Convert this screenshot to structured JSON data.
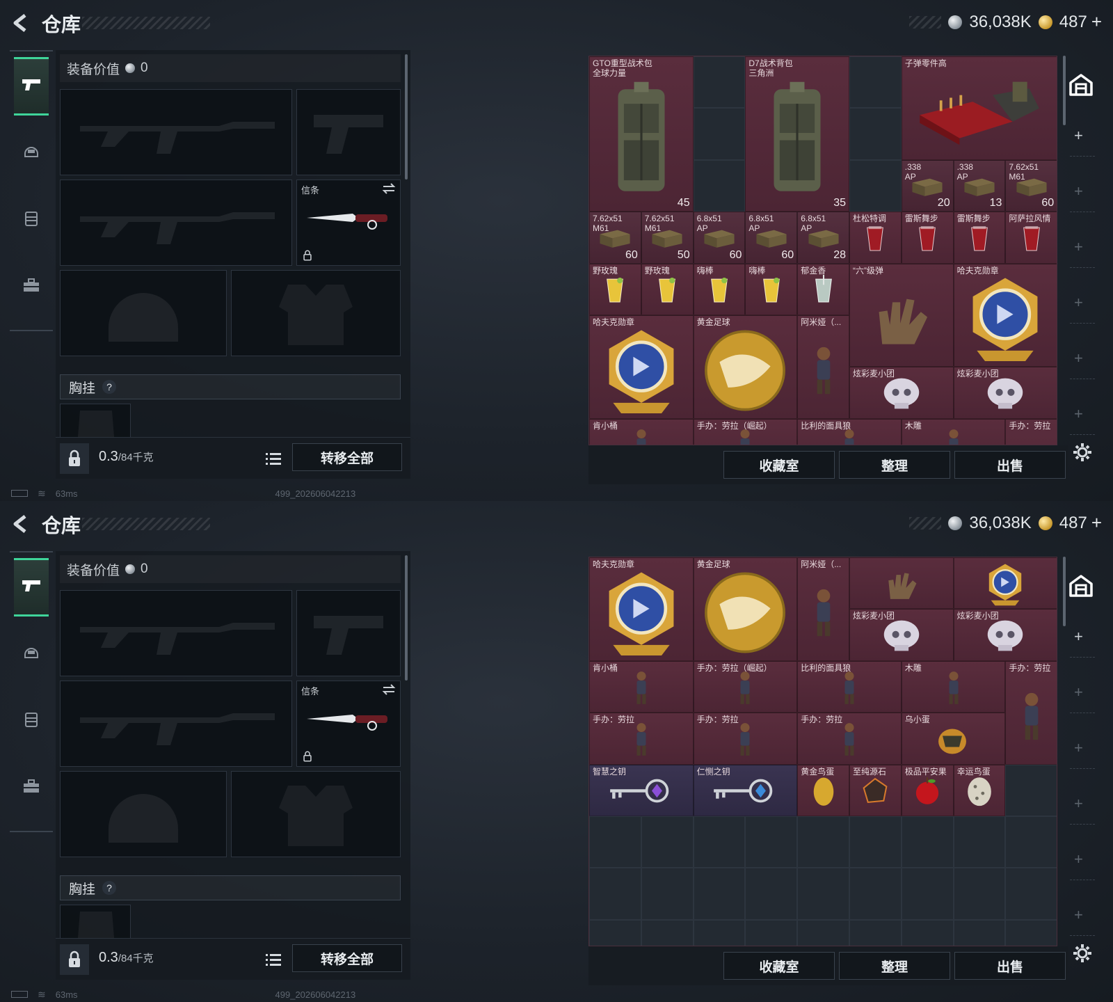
{
  "screens": [
    {
      "title": "仓库",
      "currency": {
        "silver": "36,038K",
        "gold": "487"
      },
      "equip_value_label": "装备价值",
      "equip_value": "0",
      "melee_slot_label": "信条",
      "chest_label": "胸挂",
      "weight_value": "0.3",
      "weight_unit": "/84千克",
      "transfer_all": "转移全部",
      "status_ping": "63ms",
      "status_id": "499_202606042213",
      "actions": [
        "收藏室",
        "整理",
        "出售"
      ],
      "stash_items": [
        {
          "name": "GTO重型战术包\n全球力量",
          "qty": "45",
          "tint": "maroon",
          "c": 0,
          "r": 0,
          "w": 2,
          "h": 3,
          "art": "backpack"
        },
        {
          "name": "D7战术背包\n三角洲",
          "qty": "35",
          "tint": "maroon",
          "c": 3,
          "r": 0,
          "w": 2,
          "h": 3,
          "art": "backpack"
        },
        {
          "name": "子弹零件高",
          "qty": "",
          "tint": "maroon",
          "c": 6,
          "r": 0,
          "w": 3,
          "h": 2,
          "art": "ammo-case"
        },
        {
          "name": ".338\nAP",
          "qty": "20",
          "tint": "maroon2",
          "c": 6,
          "r": 2,
          "w": 1,
          "h": 1,
          "art": "box"
        },
        {
          "name": ".338\nAP",
          "qty": "13",
          "tint": "maroon2",
          "c": 7,
          "r": 2,
          "w": 1,
          "h": 1,
          "art": "box"
        },
        {
          "name": "7.62x51\nM61",
          "qty": "60",
          "tint": "maroon2",
          "c": 8,
          "r": 2,
          "w": 1,
          "h": 1,
          "art": "box"
        },
        {
          "name": "7.62x51\nM61",
          "qty": "60",
          "tint": "maroon2",
          "c": 0,
          "r": 3,
          "w": 1,
          "h": 1,
          "art": "box"
        },
        {
          "name": "7.62x51\nM61",
          "qty": "50",
          "tint": "maroon2",
          "c": 1,
          "r": 3,
          "w": 1,
          "h": 1,
          "art": "box"
        },
        {
          "name": "6.8x51\nAP",
          "qty": "60",
          "tint": "maroon2",
          "c": 2,
          "r": 3,
          "w": 1,
          "h": 1,
          "art": "box"
        },
        {
          "name": "6.8x51\nAP",
          "qty": "60",
          "tint": "maroon2",
          "c": 3,
          "r": 3,
          "w": 1,
          "h": 1,
          "art": "box"
        },
        {
          "name": "6.8x51\nAP",
          "qty": "28",
          "tint": "maroon2",
          "c": 4,
          "r": 3,
          "w": 1,
          "h": 1,
          "art": "box"
        },
        {
          "name": "杜松特调",
          "qty": "",
          "tint": "maroon",
          "c": 5,
          "r": 3,
          "w": 1,
          "h": 1,
          "art": "drink-red"
        },
        {
          "name": "雷斯舞步",
          "qty": "",
          "tint": "maroon",
          "c": 6,
          "r": 3,
          "w": 1,
          "h": 1,
          "art": "drink-red"
        },
        {
          "name": "雷斯舞步",
          "qty": "",
          "tint": "maroon",
          "c": 7,
          "r": 3,
          "w": 1,
          "h": 1,
          "art": "drink-red"
        },
        {
          "name": "阿萨拉风情",
          "qty": "",
          "tint": "maroon",
          "c": 8,
          "r": 3,
          "w": 1,
          "h": 1,
          "art": "drink-red"
        },
        {
          "name": "野玫瑰",
          "qty": "",
          "tint": "maroon",
          "c": 0,
          "r": 4,
          "w": 1,
          "h": 1,
          "art": "drink-yellow"
        },
        {
          "name": "野玫瑰",
          "qty": "",
          "tint": "maroon",
          "c": 1,
          "r": 4,
          "w": 1,
          "h": 1,
          "art": "drink-yellow"
        },
        {
          "name": "嗨棒",
          "qty": "",
          "tint": "maroon",
          "c": 2,
          "r": 4,
          "w": 1,
          "h": 1,
          "art": "drink-yellow"
        },
        {
          "name": "嗨棒",
          "qty": "",
          "tint": "maroon",
          "c": 3,
          "r": 4,
          "w": 1,
          "h": 1,
          "art": "drink-yellow"
        },
        {
          "name": "郁金香",
          "qty": "",
          "tint": "maroon",
          "c": 4,
          "r": 4,
          "w": 1,
          "h": 1,
          "art": "drink-clear"
        },
        {
          "name": "“六”级弹",
          "qty": "",
          "tint": "maroon",
          "c": 5,
          "r": 4,
          "w": 2,
          "h": 2,
          "art": "hand"
        },
        {
          "name": "哈夫克勋章",
          "qty": "",
          "tint": "maroon",
          "c": 7,
          "r": 4,
          "w": 2,
          "h": 2,
          "art": "medal"
        },
        {
          "name": "哈夫克勋章",
          "qty": "",
          "tint": "maroon",
          "c": 0,
          "r": 5,
          "w": 2,
          "h": 2,
          "art": "medal"
        },
        {
          "name": "黄金足球",
          "qty": "",
          "tint": "maroon",
          "c": 2,
          "r": 5,
          "w": 2,
          "h": 2,
          "art": "ball"
        },
        {
          "name": "阿米娅（...",
          "qty": "",
          "tint": "maroon",
          "c": 4,
          "r": 5,
          "w": 1,
          "h": 2,
          "art": "figure"
        },
        {
          "name": "炫彩麦小团",
          "qty": "",
          "tint": "maroon",
          "c": 5,
          "r": 6,
          "w": 2,
          "h": 1,
          "art": "skull"
        },
        {
          "name": "炫彩麦小团",
          "qty": "",
          "tint": "maroon",
          "c": 7,
          "r": 6,
          "w": 2,
          "h": 1,
          "art": "skull"
        },
        {
          "name": "肯小桶",
          "qty": "",
          "tint": "maroon",
          "c": 0,
          "r": 7,
          "w": 2,
          "h": 1,
          "art": "figure"
        },
        {
          "name": "手办：劳拉（崛起）",
          "qty": "",
          "tint": "maroon",
          "c": 2,
          "r": 7,
          "w": 2,
          "h": 1,
          "art": "figure"
        },
        {
          "name": "比利的面具狼",
          "qty": "",
          "tint": "maroon",
          "c": 4,
          "r": 7,
          "w": 2,
          "h": 1,
          "art": "figure"
        },
        {
          "name": "木雕",
          "qty": "",
          "tint": "maroon",
          "c": 6,
          "r": 7,
          "w": 2,
          "h": 1,
          "art": "figure"
        },
        {
          "name": "手办：劳拉",
          "qty": "",
          "tint": "maroon",
          "c": 8,
          "r": 7,
          "w": 1,
          "h": 2,
          "art": "figure"
        }
      ]
    },
    {
      "title": "仓库",
      "currency": {
        "silver": "36,038K",
        "gold": "487"
      },
      "equip_value_label": "装备价值",
      "equip_value": "0",
      "melee_slot_label": "信条",
      "chest_label": "胸挂",
      "weight_value": "0.3",
      "weight_unit": "/84千克",
      "transfer_all": "转移全部",
      "status_ping": "63ms",
      "status_id": "499_202606042213",
      "actions": [
        "收藏室",
        "整理",
        "出售"
      ],
      "stash_items": [
        {
          "name": "哈夫克勋章",
          "qty": "",
          "tint": "maroon",
          "c": 0,
          "r": 0,
          "w": 2,
          "h": 2,
          "art": "medal"
        },
        {
          "name": "黄金足球",
          "qty": "",
          "tint": "maroon",
          "c": 2,
          "r": 0,
          "w": 2,
          "h": 2,
          "art": "ball"
        },
        {
          "name": "阿米娅（...",
          "qty": "",
          "tint": "maroon",
          "c": 4,
          "r": 0,
          "w": 1,
          "h": 2,
          "art": "figure"
        },
        {
          "name": "",
          "qty": "",
          "tint": "maroon",
          "c": 5,
          "r": 0,
          "w": 2,
          "h": 1,
          "art": "hand"
        },
        {
          "name": "",
          "qty": "",
          "tint": "maroon",
          "c": 7,
          "r": 0,
          "w": 2,
          "h": 1,
          "art": "medal"
        },
        {
          "name": "炫彩麦小团",
          "qty": "",
          "tint": "maroon",
          "c": 5,
          "r": 1,
          "w": 2,
          "h": 1,
          "art": "skull"
        },
        {
          "name": "炫彩麦小团",
          "qty": "",
          "tint": "maroon",
          "c": 7,
          "r": 1,
          "w": 2,
          "h": 1,
          "art": "skull"
        },
        {
          "name": "肯小桶",
          "qty": "",
          "tint": "maroon",
          "c": 0,
          "r": 2,
          "w": 2,
          "h": 1,
          "art": "figure"
        },
        {
          "name": "手办：劳拉（崛起）",
          "qty": "",
          "tint": "maroon",
          "c": 2,
          "r": 2,
          "w": 2,
          "h": 1,
          "art": "figure"
        },
        {
          "name": "比利的面具狼",
          "qty": "",
          "tint": "maroon",
          "c": 4,
          "r": 2,
          "w": 2,
          "h": 1,
          "art": "figure"
        },
        {
          "name": "木雕",
          "qty": "",
          "tint": "maroon",
          "c": 6,
          "r": 2,
          "w": 2,
          "h": 1,
          "art": "figure"
        },
        {
          "name": "手办：劳拉",
          "qty": "",
          "tint": "maroon",
          "c": 8,
          "r": 2,
          "w": 1,
          "h": 2,
          "art": "figure"
        },
        {
          "name": "手办：劳拉",
          "qty": "",
          "tint": "maroon",
          "c": 0,
          "r": 3,
          "w": 2,
          "h": 1,
          "art": "figure"
        },
        {
          "name": "手办：劳拉",
          "qty": "",
          "tint": "maroon",
          "c": 2,
          "r": 3,
          "w": 2,
          "h": 1,
          "art": "figure"
        },
        {
          "name": "手办：劳拉",
          "qty": "",
          "tint": "maroon",
          "c": 4,
          "r": 3,
          "w": 2,
          "h": 1,
          "art": "figure"
        },
        {
          "name": "乌小蛋",
          "qty": "",
          "tint": "maroon",
          "c": 6,
          "r": 3,
          "w": 2,
          "h": 1,
          "art": "egg-dark"
        },
        {
          "name": "智慧之钥",
          "qty": "",
          "tint": "purple",
          "c": 0,
          "r": 4,
          "w": 2,
          "h": 1,
          "art": "key-purple"
        },
        {
          "name": "仁恻之钥",
          "qty": "",
          "tint": "purple",
          "c": 2,
          "r": 4,
          "w": 2,
          "h": 1,
          "art": "key-blue"
        },
        {
          "name": "黄金鸟蛋",
          "qty": "",
          "tint": "maroon",
          "c": 4,
          "r": 4,
          "w": 1,
          "h": 1,
          "art": "egg-gold"
        },
        {
          "name": "至纯源石",
          "qty": "",
          "tint": "maroon",
          "c": 5,
          "r": 4,
          "w": 1,
          "h": 1,
          "art": "stone"
        },
        {
          "name": "极品平安果",
          "qty": "",
          "tint": "maroon",
          "c": 6,
          "r": 4,
          "w": 1,
          "h": 1,
          "art": "apple"
        },
        {
          "name": "幸运鸟蛋",
          "qty": "",
          "tint": "maroon",
          "c": 7,
          "r": 4,
          "w": 1,
          "h": 1,
          "art": "egg-spotted"
        }
      ]
    }
  ],
  "icons": {
    "back": "back-arrow-icon",
    "silver": "silver-coin-icon",
    "gold": "gold-coin-icon",
    "tabs": [
      "gun-icon",
      "helmet-icon",
      "vest-icon",
      "toolbox-icon"
    ],
    "rail": "warehouse-icon",
    "settings": "gear-icon",
    "list": "list-icon",
    "lock": "lock-icon",
    "swap": "swap-icon"
  }
}
